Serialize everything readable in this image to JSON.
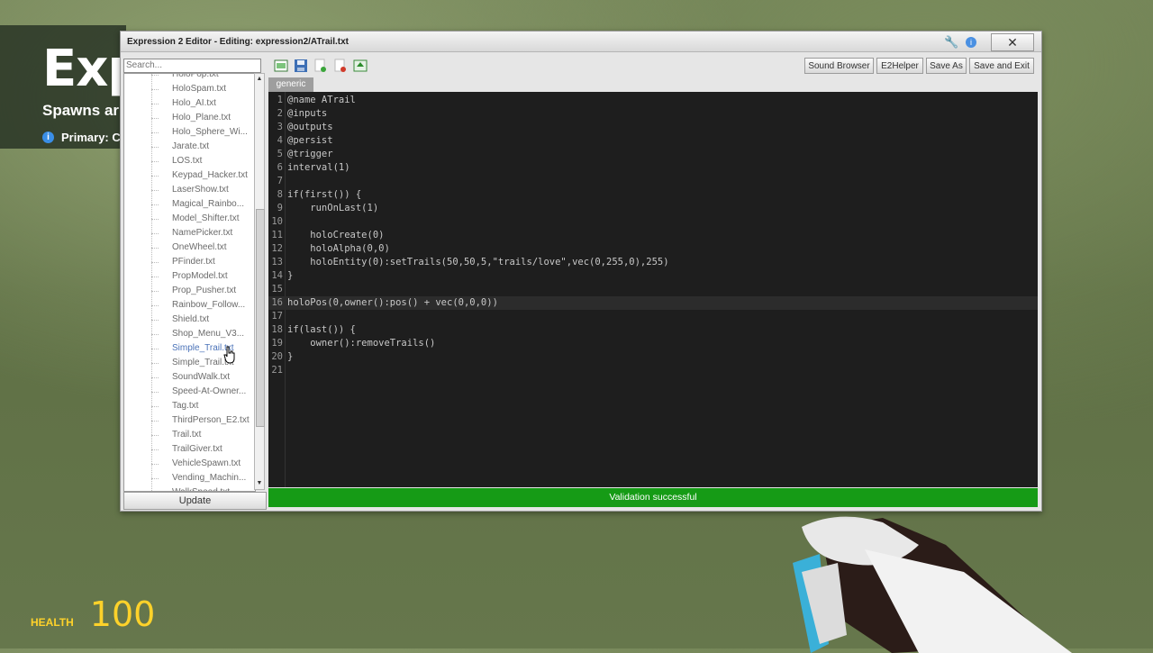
{
  "game": {
    "title": "Exp",
    "subtitle": "Spawns ar",
    "primary": "Primary: C",
    "health_label": "HEALTH",
    "health_value": "100"
  },
  "window": {
    "title": "Expression 2 Editor - Editing: expression2/ATrail.txt",
    "close_glyph": "✕",
    "icons": [
      "wrench-icon",
      "info-icon"
    ]
  },
  "browser": {
    "search_placeholder": "Search...",
    "files": [
      "HoloPop.txt",
      "HoloSpam.txt",
      "Holo_AI.txt",
      "Holo_Plane.txt",
      "Holo_Sphere_Wi...",
      "Jarate.txt",
      "LOS.txt",
      "Keypad_Hacker.txt",
      "LaserShow.txt",
      "Magical_Rainbo...",
      "Model_Shifter.txt",
      "NamePicker.txt",
      "OneWheel.txt",
      "PFinder.txt",
      "PropModel.txt",
      "Prop_Pusher.txt",
      "Rainbow_Follow...",
      "Shield.txt",
      "Shop_Menu_V3...",
      "Simple_Trail.txt",
      "Simple_Trail.txt",
      "SoundWalk.txt",
      "Speed-At-Owner...",
      "Tag.txt",
      "ThirdPerson_E2.txt",
      "Trail.txt",
      "TrailGiver.txt",
      "VehicleSpawn.txt",
      "Vending_Machin...",
      "WalkSpeed.txt"
    ],
    "update_label": "Update"
  },
  "toolbar": {
    "sound_browser": "Sound Browser",
    "e2helper": "E2Helper",
    "save_as": "Save As",
    "save_exit": "Save and Exit"
  },
  "tab": {
    "label": "generic"
  },
  "editor": {
    "lines": [
      {
        "n": "1",
        "code": "@name ATrail"
      },
      {
        "n": "2",
        "code": "@inputs"
      },
      {
        "n": "3",
        "code": "@outputs"
      },
      {
        "n": "4",
        "code": "@persist"
      },
      {
        "n": "5",
        "code": "@trigger"
      },
      {
        "n": "6",
        "code": "interval(1)"
      },
      {
        "n": "7",
        "code": ""
      },
      {
        "n": "8",
        "code": "if(first()) {"
      },
      {
        "n": "9",
        "code": "    runOnLast(1)"
      },
      {
        "n": "10",
        "code": ""
      },
      {
        "n": "11",
        "code": "    holoCreate(0)"
      },
      {
        "n": "12",
        "code": "    holoAlpha(0,0)"
      },
      {
        "n": "13",
        "code": "    holoEntity(0):setTrails(50,50,5,\"trails/love\",vec(0,255,0),255)"
      },
      {
        "n": "14",
        "code": "}"
      },
      {
        "n": "15",
        "code": ""
      },
      {
        "n": "16",
        "code": "holoPos(0,owner():pos() + vec(0,0,0))"
      },
      {
        "n": "17",
        "code": ""
      },
      {
        "n": "18",
        "code": "if(last()) {"
      },
      {
        "n": "19",
        "code": "    owner():removeTrails()"
      },
      {
        "n": "20",
        "code": "}"
      },
      {
        "n": "21",
        "code": ""
      }
    ],
    "current_line": 16
  },
  "status": {
    "text": "Validation successful",
    "color": "#169b16"
  }
}
